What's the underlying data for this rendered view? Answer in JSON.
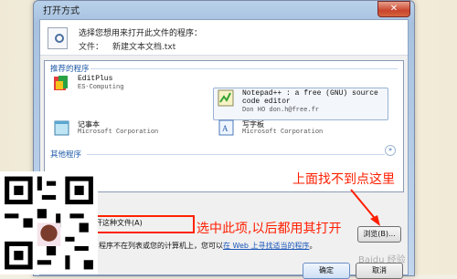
{
  "window": {
    "title": "打开方式",
    "close_glyph": "✕"
  },
  "header": {
    "prompt": "选择您想用来打开此文件的程序：",
    "file_label": "文件：",
    "file_name": "新建文本文档.txt"
  },
  "list": {
    "recommended_label": "推荐的程序",
    "other_label": "其他程序",
    "other_chevron": "»",
    "programs": [
      {
        "name": "EditPlus",
        "publisher": "ES-Computing",
        "icon": "editplus-icon"
      },
      {
        "name": "Notepad++ : a free (GNU) source",
        "name2": "code editor",
        "publisher": "Don HO don.h@free.fr",
        "icon": "notepadpp-icon"
      },
      {
        "name": "记事本",
        "publisher": "Microsoft Corporation",
        "icon": "notepad-icon"
      },
      {
        "name": "写字板",
        "publisher": "Microsoft Corporation",
        "icon": "wordpad-icon"
      }
    ]
  },
  "always_use": {
    "label": "择的程序打开这种文件(A)",
    "checked": false
  },
  "browse_label": "浏览(B)...",
  "not_found": {
    "prefix": "程序不在列表或您的计算机上，您可以",
    "link": "在 Web 上寻找适当的程序",
    "suffix": "。"
  },
  "buttons": {
    "ok": "确定",
    "cancel": "取消"
  },
  "annotations": {
    "top": "上面找不到点这里",
    "bottom": "选中此项,以后都用其打开",
    "color": "#ff1e00"
  },
  "watermark": "Baidu 经验"
}
